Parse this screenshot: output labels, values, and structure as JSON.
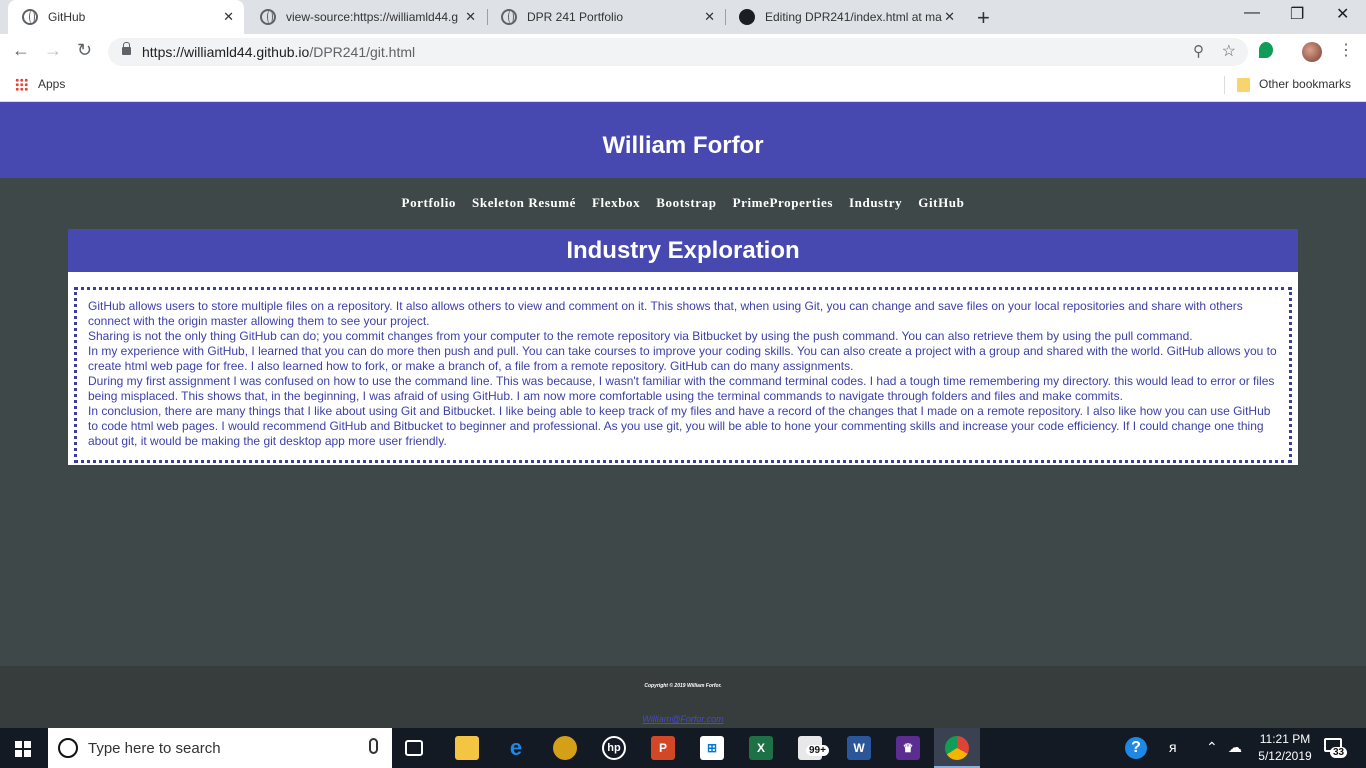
{
  "browser": {
    "tabs": [
      {
        "title": "GitHub",
        "icon": "globe-icon",
        "active": true
      },
      {
        "title": "view-source:https://williamld44.g",
        "icon": "globe-icon",
        "active": false
      },
      {
        "title": "DPR 241 Portfolio",
        "icon": "globe-icon",
        "active": false
      },
      {
        "title": "Editing DPR241/index.html at ma",
        "icon": "github-icon",
        "active": false
      }
    ],
    "new_tab": "+",
    "window_controls": {
      "minimize": "—",
      "restore": "❐",
      "close": "✕"
    },
    "nav": {
      "back": "←",
      "forward": "→",
      "reload": "↻"
    },
    "address": {
      "host": "https://williamld44.github.io",
      "path": "/DPR241/git.html"
    },
    "bookmarks": {
      "apps": "Apps",
      "other": "Other bookmarks"
    }
  },
  "site": {
    "title": "William Forfor",
    "nav": [
      "Portfolio",
      "Skeleton Resumé",
      "Flexbox",
      "Bootstrap",
      "PrimeProperties",
      "Industry",
      "GitHub"
    ],
    "section_title": "Industry Exploration",
    "paragraphs": [
      "GitHub allows users to store multiple files on a repository. It also allows others to view and comment on it. This shows that, when using Git, you can change and save files on your local repositories and share with others connect with the origin master allowing them to see your project.",
      "Sharing is not the only thing GitHub can do; you commit changes from your computer to the remote repository via Bitbucket by using the push command. You can also retrieve them by using the pull command.",
      "In my experience with GitHub, I learned that you can do more then push and pull. You can take courses to improve your coding skills. You can also create a project with a group and shared with the world. GitHub allows you to create html web page for free. I also learned how to fork, or make a branch of, a file from a remote repository. GitHub can do many assignments.",
      "During my first assignment I was confused on how to use the command line. This was because, I wasn't familiar with the command terminal codes. I had a tough time remembering my directory. this would lead to error or files being misplaced. This shows that, in the beginning, I was afraid of using GitHub. I am now more comfortable using the terminal commands to navigate through folders and files and make commits.",
      "In conclusion, there are many things that I like about using Git and Bitbucket. I like being able to keep track of my files and have a record of the changes that I made on a remote repository. I also like how you can use GitHub to code html web pages. I would recommend GitHub and Bitbucket to beginner and professional. As you use git, you will be able to hone your commenting skills and increase your code efficiency. If I could change one thing about git, it would be making the git desktop app more user friendly."
    ],
    "footer": {
      "copyright": "Copyright © 2019 William Forfor.",
      "email": "William@Forfor.com"
    },
    "colors": {
      "header": "#4749b1",
      "body": "#3f4848",
      "text": "#3e41a8",
      "footer": "#373c3c"
    }
  },
  "taskbar": {
    "search_placeholder": "Type here to search",
    "mail_badge": "99+",
    "time": "11:21 PM",
    "date": "5/12/2019",
    "notifications": "33",
    "help": "?"
  }
}
